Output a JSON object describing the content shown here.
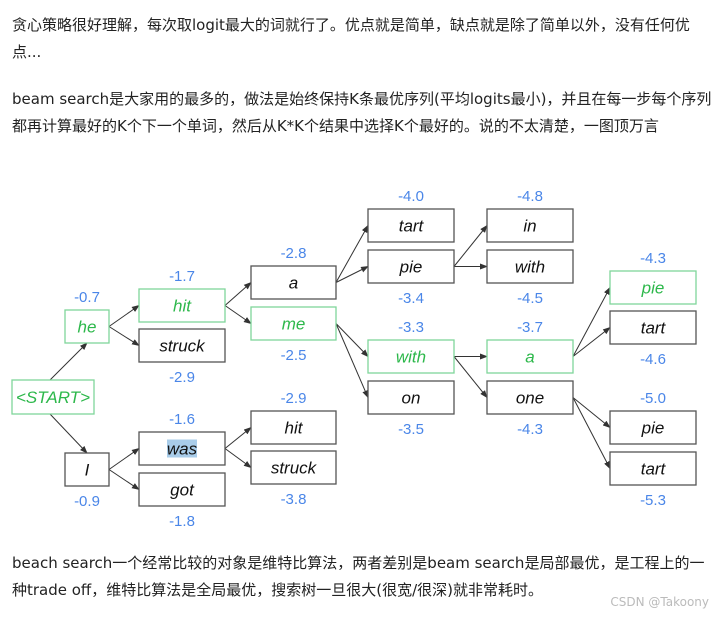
{
  "paragraphs": [
    "贪心策略很好理解，每次取logit最大的词就行了。优点就是简单，缺点就是除了简单以外，没有任何优点...",
    "beam search是大家用的最多的，做法是始终保持K条最优序列(平均logits最小)，并且在每一步每个序列都再计算最好的K个下一个单词，然后从K*K个结果中选择K个最好的。说的不太清楚，一图顶万言",
    "beach search一个经常比较的对象是维特比算法，两者差别是beam search是局部最优，是工程上的一种trade off，维特比算法是全局最优，搜索树一旦很大(很宽/很深)就非常耗时。"
  ],
  "watermark": "CSDN @Takoony",
  "colors": {
    "selected": "#2db84b",
    "selected_border": "#7fd69a",
    "score": "#4a86e8",
    "normal_border": "#555555",
    "highlight": "#a9cdea"
  },
  "diagram": {
    "nodes": [
      {
        "id": "start",
        "label": "<START>",
        "selected": true
      },
      {
        "id": "he",
        "label": "he",
        "score": "-0.7",
        "parent": "start",
        "selected": true
      },
      {
        "id": "I",
        "label": "I",
        "score": "-0.9",
        "parent": "start"
      },
      {
        "id": "hit",
        "label": "hit",
        "score": "-1.7",
        "parent": "he",
        "selected": true
      },
      {
        "id": "struck",
        "label": "struck",
        "score": "-2.9",
        "parent": "he"
      },
      {
        "id": "was",
        "label": "was",
        "score": "-1.6",
        "parent": "I",
        "highlighted": true
      },
      {
        "id": "got",
        "label": "got",
        "score": "-1.8",
        "parent": "I"
      },
      {
        "id": "a",
        "label": "a",
        "score": "-2.8",
        "parent": "hit"
      },
      {
        "id": "me",
        "label": "me",
        "score": "-2.5",
        "parent": "hit",
        "selected": true
      },
      {
        "id": "hit2",
        "label": "hit",
        "score": "-2.9",
        "parent": "was"
      },
      {
        "id": "struck2",
        "label": "struck",
        "score": "-3.8",
        "parent": "was"
      },
      {
        "id": "tart",
        "label": "tart",
        "score": "-4.0",
        "parent": "a"
      },
      {
        "id": "pie",
        "label": "pie",
        "score": "-3.4",
        "parent": "a"
      },
      {
        "id": "with",
        "label": "with",
        "score": "-3.3",
        "parent": "me",
        "selected": true
      },
      {
        "id": "on",
        "label": "on",
        "score": "-3.5",
        "parent": "me"
      },
      {
        "id": "in",
        "label": "in",
        "score": "-4.8",
        "parent": "pie"
      },
      {
        "id": "with2",
        "label": "with",
        "score": "-4.5",
        "parent": "pie"
      },
      {
        "id": "a2",
        "label": "a",
        "score": "-3.7",
        "parent": "with",
        "selected": true
      },
      {
        "id": "one",
        "label": "one",
        "score": "-4.3",
        "parent": "with"
      },
      {
        "id": "pie3",
        "label": "pie",
        "score": "-4.3",
        "parent": "a2",
        "selected": true
      },
      {
        "id": "tart3",
        "label": "tart",
        "score": "-4.6",
        "parent": "a2"
      },
      {
        "id": "pie4",
        "label": "pie",
        "score": "-5.0",
        "parent": "one"
      },
      {
        "id": "tart4",
        "label": "tart",
        "score": "-5.3",
        "parent": "one"
      }
    ]
  }
}
